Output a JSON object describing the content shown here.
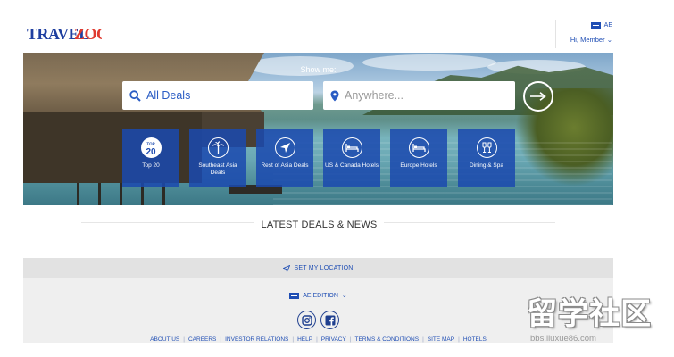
{
  "brand": {
    "logo_text": "TRAVELZOO",
    "logo_color": "#1f3fa0",
    "logo_accent": "#e03a2f"
  },
  "header": {
    "edition": "AE",
    "member": "Hi, Member"
  },
  "hero": {
    "prompt": "Show me:",
    "deals_value": "All Deals",
    "location_placeholder": "Anywhere...",
    "tiles": [
      {
        "label": "Top 20",
        "icon": "top-20-icon"
      },
      {
        "label": "Southeast Asia Deals",
        "icon": "palm-tree-icon"
      },
      {
        "label": "Rest of Asia Deals",
        "icon": "compass-arrow-icon"
      },
      {
        "label": "US & Canada Hotels",
        "icon": "bed-icon"
      },
      {
        "label": "Europe Hotels",
        "icon": "bed-icon"
      },
      {
        "label": "Dining & Spa",
        "icon": "glasses-icon"
      }
    ],
    "top20_badge_top": "TOP",
    "top20_badge_num": "20"
  },
  "latest": {
    "title": "LATEST DEALS & NEWS"
  },
  "footer": {
    "location": "SET MY LOCATION",
    "edition": "AE EDITION",
    "links": [
      "ABOUT US",
      "CAREERS",
      "INVESTOR RELATIONS",
      "HELP",
      "PRIVACY",
      "TERMS & CONDITIONS",
      "SITE MAP",
      "HOTELS"
    ]
  },
  "watermark": {
    "text": "留学社区",
    "url": "bbs.liuxue86.com"
  },
  "colors": {
    "primary": "#1f4eb4",
    "tile": "#1b49af"
  }
}
